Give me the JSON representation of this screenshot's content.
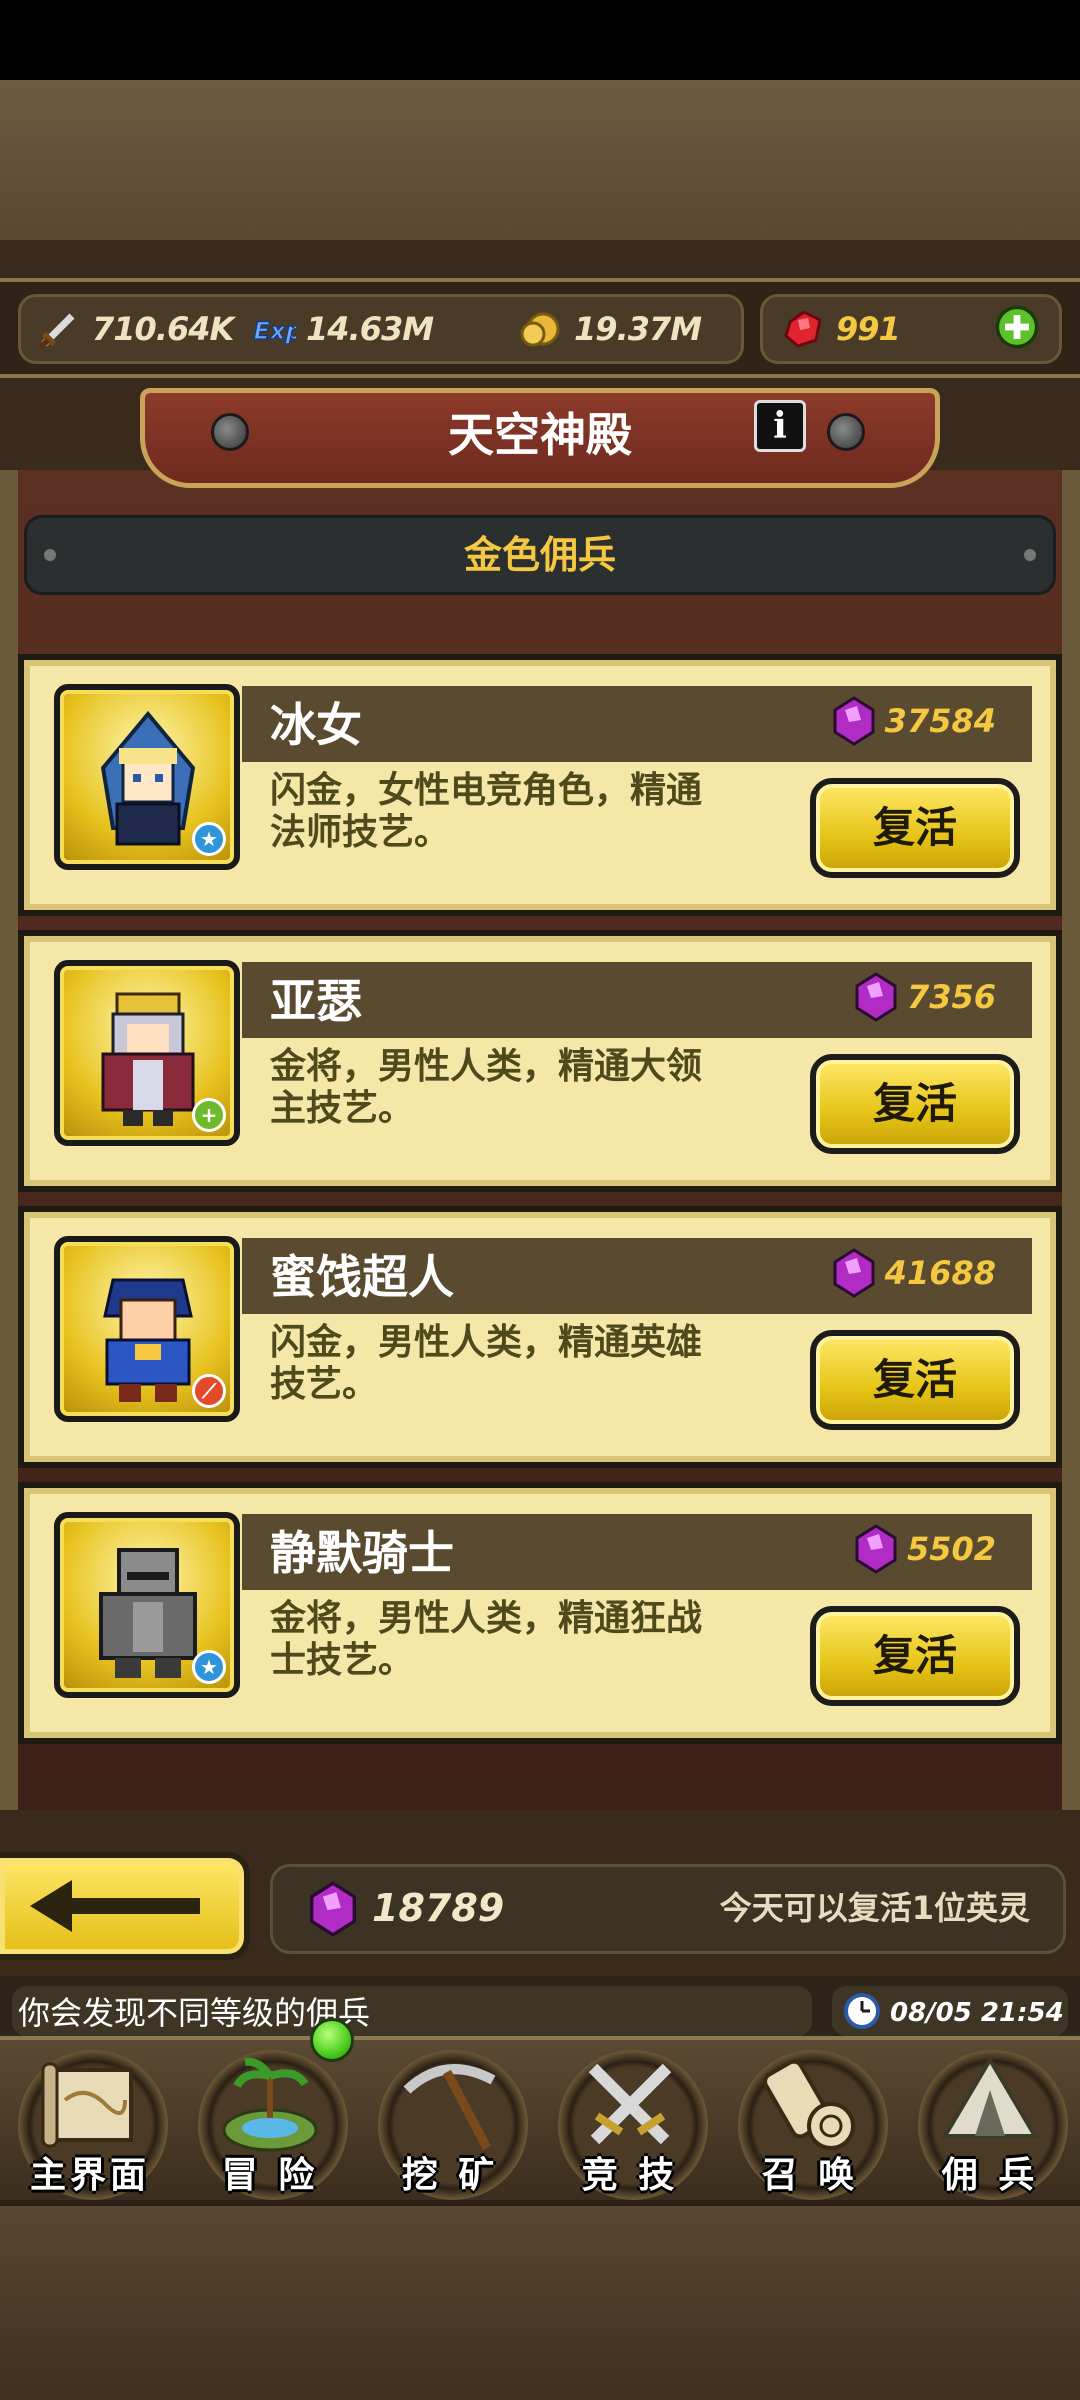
{
  "resources": {
    "attack": {
      "icon": "sword-icon",
      "value": "710.64K"
    },
    "exp": {
      "icon": "exp-icon",
      "value": "14.63M"
    },
    "gold": {
      "icon": "gold-coin-icon",
      "value": "19.37M"
    },
    "ruby": {
      "icon": "ruby-icon",
      "value": "991"
    },
    "add_icon": "plus-icon"
  },
  "header": {
    "title": "天空神殿",
    "info_label": "i"
  },
  "section": {
    "title": "金色佣兵"
  },
  "heroes": [
    {
      "name": "冰女",
      "cost": "37584",
      "desc_line1": "闪金，女性电竞角色，精通",
      "desc_line2": "法师技艺。",
      "button": "复活",
      "badge": "★",
      "badge_color": "#2f95d8"
    },
    {
      "name": "亚瑟",
      "cost": "7356",
      "desc_line1": "金将，男性人类，精通大领",
      "desc_line2": "主技艺。",
      "button": "复活",
      "badge": "+",
      "badge_color": "#6dbb2a"
    },
    {
      "name": "蜜饯超人",
      "cost": "41688",
      "desc_line1": "闪金，男性人类，精通英雄",
      "desc_line2": "技艺。",
      "button": "复活",
      "badge": "⟋",
      "badge_color": "#e24a2a"
    },
    {
      "name": "静默骑士",
      "cost": "5502",
      "desc_line1": "金将，男性人类，精通狂战",
      "desc_line2": "士技艺。",
      "button": "复活",
      "badge": "★",
      "badge_color": "#2f95d8"
    }
  ],
  "footer": {
    "gem_total": "18789",
    "daily_note": "今天可以复活1位英灵",
    "ticker": "你会发现不同等级的佣兵",
    "clock": "08/05 21:54"
  },
  "nav": [
    {
      "label": "主界面",
      "icon": "map-scroll-icon"
    },
    {
      "label": "冒 险",
      "icon": "island-icon"
    },
    {
      "label": "挖 矿",
      "icon": "pickaxe-icon"
    },
    {
      "label": "竞 技",
      "icon": "crossed-swords-icon"
    },
    {
      "label": "召 唤",
      "icon": "summon-scroll-icon"
    },
    {
      "label": "佣 兵",
      "icon": "tent-icon"
    }
  ],
  "colors": {
    "gold_text": "#f5c842",
    "card_bg": "#f4e7a8",
    "button_gold": "#e6c417",
    "gem_purple": "#b02cc4",
    "banner_red": "#8c3a2a"
  }
}
